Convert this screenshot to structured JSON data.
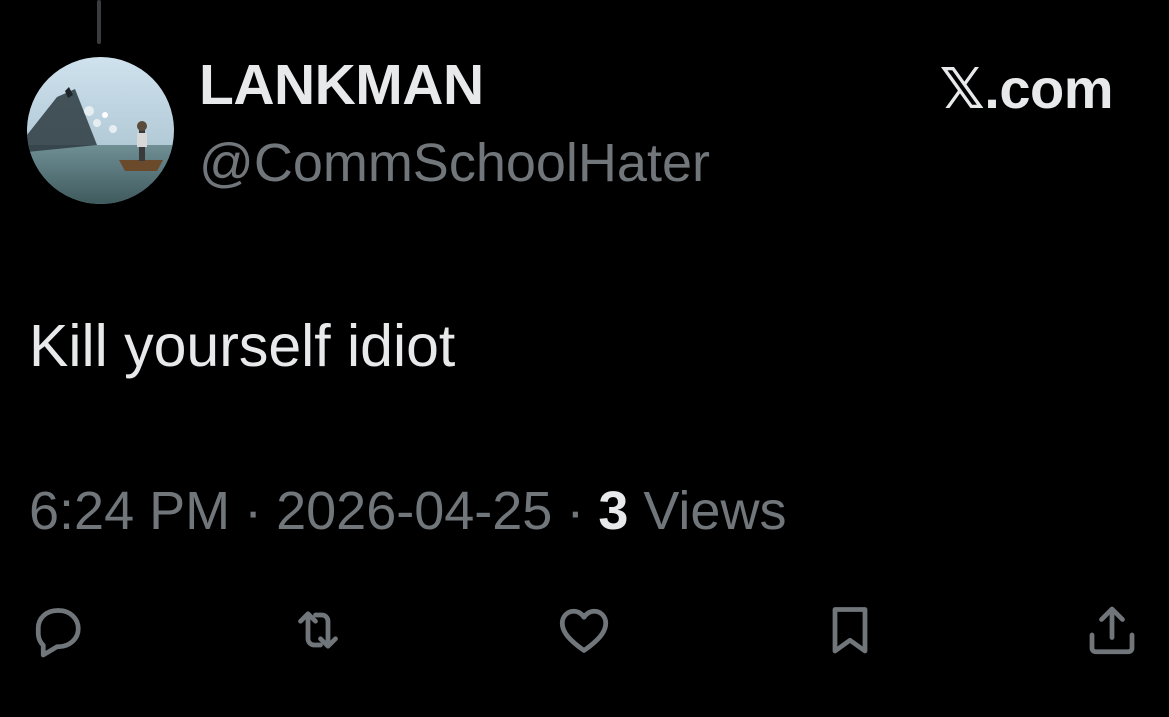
{
  "author": {
    "display_name": "LANKMAN",
    "handle": "@CommSchoolHater"
  },
  "brand": "𝕏.com",
  "tweet": {
    "text": "Kill yourself idiot"
  },
  "meta": {
    "time": "6:24 PM",
    "date": "2026-04-25",
    "separator": "·",
    "views_count": "3",
    "views_label": "Views"
  },
  "actions": [
    {
      "name": "reply",
      "icon": "reply-icon"
    },
    {
      "name": "retweet",
      "icon": "retweet-icon"
    },
    {
      "name": "like",
      "icon": "heart-icon"
    },
    {
      "name": "bookmark",
      "icon": "bookmark-icon"
    },
    {
      "name": "share",
      "icon": "share-icon"
    }
  ],
  "colors": {
    "background": "#000000",
    "primary_text": "#e7e9ea",
    "secondary_text": "#71767b"
  }
}
